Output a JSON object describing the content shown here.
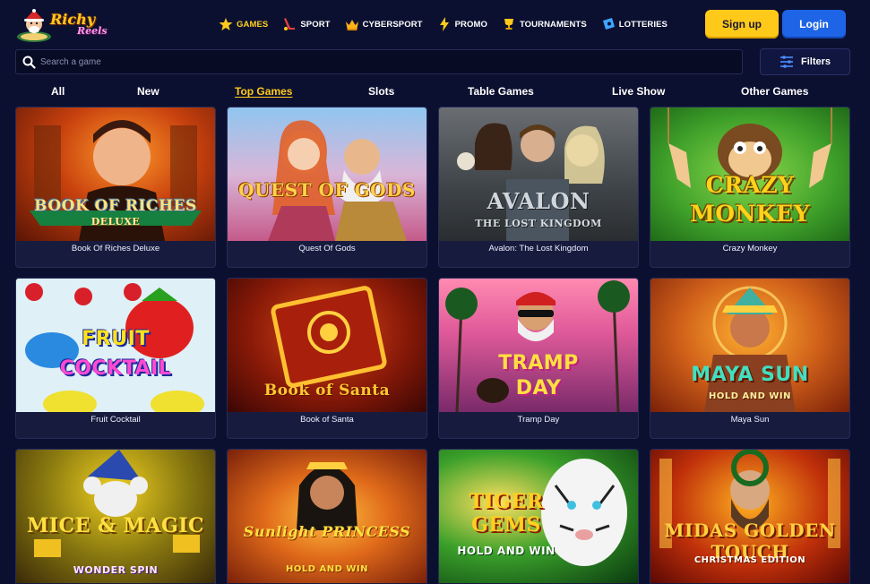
{
  "brand": {
    "line1": "Richy",
    "line2": "Reels"
  },
  "nav": [
    {
      "label": "GAMES",
      "icon": "star-icon",
      "active": true
    },
    {
      "label": "SPORT",
      "icon": "hockey-stick-icon",
      "active": false
    },
    {
      "label": "CYBERSPORT",
      "icon": "crown-icon",
      "active": false
    },
    {
      "label": "PROMO",
      "icon": "lightning-icon",
      "active": false
    },
    {
      "label": "TOURNAMENTS",
      "icon": "trophy-icon",
      "active": false
    },
    {
      "label": "LOTTERIES",
      "icon": "ticket-icon",
      "active": false
    }
  ],
  "auth": {
    "signup": "Sign up",
    "login": "Login"
  },
  "search": {
    "placeholder": "Search a game"
  },
  "filters": {
    "label": "Filters"
  },
  "tabs": [
    {
      "label": "All",
      "active": false
    },
    {
      "label": "New",
      "active": false
    },
    {
      "label": "Top Games",
      "active": true
    },
    {
      "label": "Slots",
      "active": false
    },
    {
      "label": "Table Games",
      "active": false
    },
    {
      "label": "Live Show",
      "active": false
    },
    {
      "label": "Other Games",
      "active": false
    }
  ],
  "games": [
    {
      "name": "Book Of Riches Deluxe",
      "art_title": "BOOK OF RICHES",
      "art_sub": "DELUXE"
    },
    {
      "name": "Quest Of Gods",
      "art_title": "QUEST OF GODS",
      "art_sub": ""
    },
    {
      "name": "Avalon: The Lost Kingdom",
      "art_title": "AVALON",
      "art_sub": "THE LOST KINGDOM"
    },
    {
      "name": "Crazy Monkey",
      "art_title": "CRAZY",
      "art_sub": "MONKEY"
    },
    {
      "name": "Fruit Cocktail",
      "art_title": "FRUIT",
      "art_sub": "COCKTAIL"
    },
    {
      "name": "Book of Santa",
      "art_title": "Book of Santa",
      "art_sub": ""
    },
    {
      "name": "Tramp Day",
      "art_title": "TRAMP",
      "art_sub": "DAY"
    },
    {
      "name": "Maya Sun",
      "art_title": "MAYA SUN",
      "art_sub": "HOLD AND WIN"
    },
    {
      "name": "",
      "art_title": "MICE & MAGIC",
      "art_sub": "WONDER SPIN"
    },
    {
      "name": "",
      "art_title": "Sunlight PRINCESS",
      "art_sub": "HOLD AND WIN"
    },
    {
      "name": "",
      "art_title": "TIGER GEMS",
      "art_sub": "HOLD AND WIN"
    },
    {
      "name": "",
      "art_title": "MIDAS GOLDEN TOUCH",
      "art_sub": "CHRISTMAS EDITION"
    }
  ],
  "colors": {
    "accent": "#ffc91a",
    "login": "#1e64e6",
    "background": "#0c1030"
  }
}
